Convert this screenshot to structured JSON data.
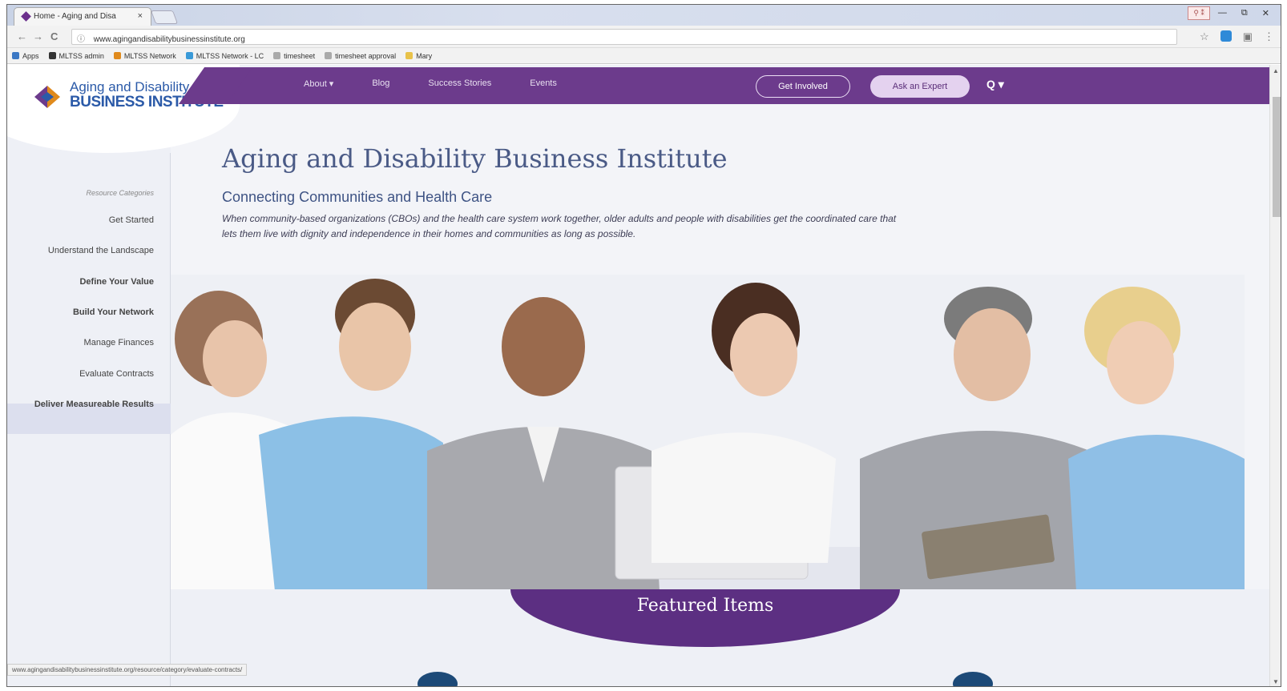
{
  "browser": {
    "tab_title": "Home - Aging and Disa",
    "tab_close": "×",
    "url": "www.agingandisabilitybusinessinstitute.org",
    "url_info_icon": "info-icon",
    "nav_back": "←",
    "nav_forward": "→",
    "nav_reload": "C",
    "bookmarks": [
      {
        "label": "Apps",
        "icon": "apps-icon",
        "color": "#3b78c4"
      },
      {
        "label": "MLTSS admin",
        "icon": "mltss-icon",
        "color": "#333333"
      },
      {
        "label": "MLTSS Network",
        "icon": "mltss-network-icon",
        "color": "#e08a1c"
      },
      {
        "label": "MLTSS Network - LC",
        "icon": "globe-icon",
        "color": "#3a9ad8"
      },
      {
        "label": "timesheet",
        "icon": "page-icon",
        "color": "#aaaaaa"
      },
      {
        "label": "timesheet approval",
        "icon": "page-icon",
        "color": "#aaaaaa"
      },
      {
        "label": "Mary",
        "icon": "folder-icon",
        "color": "#e8c24a"
      }
    ],
    "win_min": "—",
    "win_max": "⧉",
    "win_close": "✕",
    "star": "☆",
    "menu": "⋮"
  },
  "header": {
    "logo_line1": "Aging and Disability",
    "logo_line2": "BUSINESS INSTITUTE",
    "nav": [
      "About ▾",
      "Blog",
      "Success Stories",
      "Events"
    ],
    "get_involved": "Get Involved",
    "ask_expert": "Ask an Expert",
    "search_icon": "Q ▾",
    "brand_color": "#6c3b8c"
  },
  "sidebar": {
    "heading": "Resource Categories",
    "items": [
      {
        "label": "Get Started",
        "bold": false
      },
      {
        "label": "Understand the Landscape",
        "bold": false
      },
      {
        "label": "Define Your Value",
        "bold": true
      },
      {
        "label": "Build Your Network",
        "bold": true
      },
      {
        "label": "Manage Finances",
        "bold": false
      },
      {
        "label": "Evaluate Contracts",
        "bold": false,
        "active": true
      },
      {
        "label": "Deliver Measureable Results",
        "bold": true
      }
    ]
  },
  "hero": {
    "title": "Aging and Disability Business Institute",
    "subtitle": "Connecting Communities and Health Care",
    "intro": "When community-based organizations (CBOs) and the health care system work together, older adults and people with disabilities get the coordinated care that lets them live with dignity and independence in their homes and communities as long as possible."
  },
  "featured": {
    "title": "Featured Items"
  },
  "status_bar": {
    "url": "www.agingandisabilitybusinessinstitute.org/resource/category/evaluate-contracts/"
  }
}
